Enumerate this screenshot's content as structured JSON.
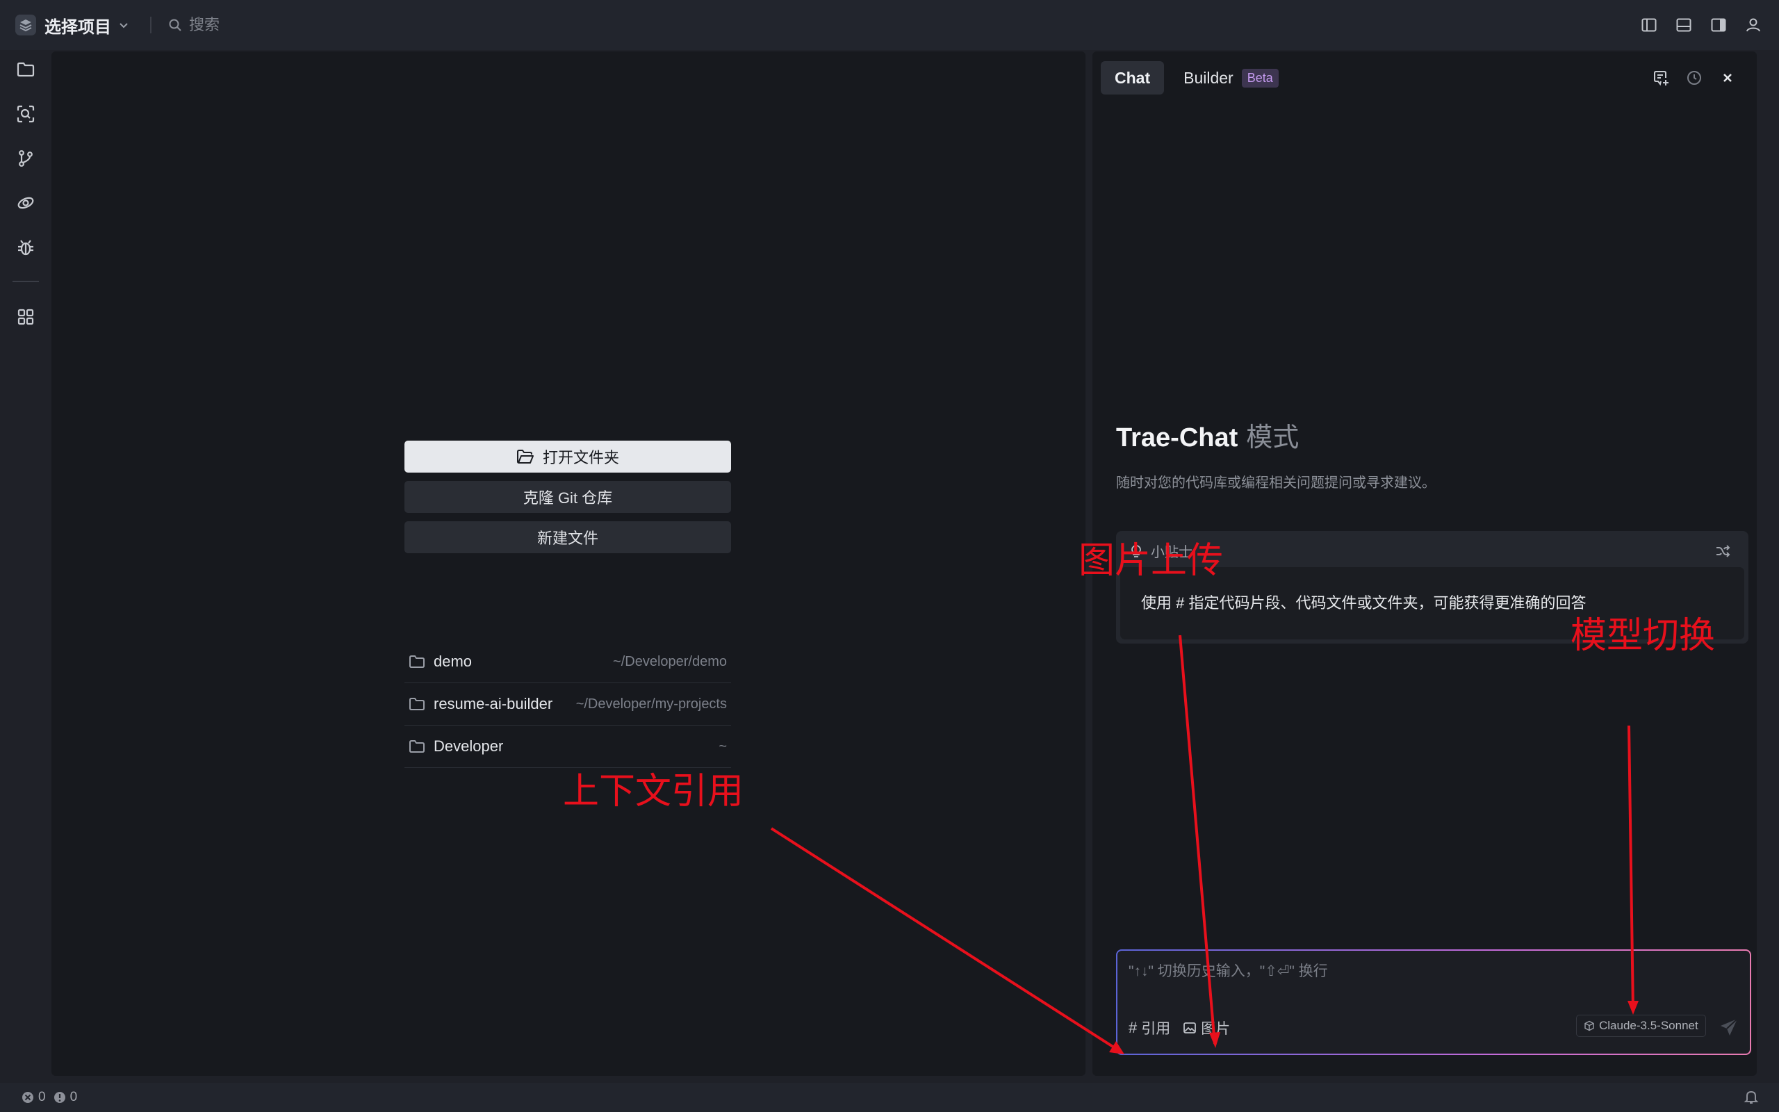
{
  "titlebar": {
    "project_name": "选择项目",
    "search_placeholder": "搜索"
  },
  "editor": {
    "actions": {
      "open_folder": "打开文件夹",
      "clone_git": "克隆 Git 仓库",
      "new_file": "新建文件"
    },
    "recent": [
      {
        "name": "demo",
        "path": "~/Developer/demo"
      },
      {
        "name": "resume-ai-builder",
        "path": "~/Developer/my-projects"
      },
      {
        "name": "Developer",
        "path": "~"
      }
    ]
  },
  "chat": {
    "tabs": {
      "chat": "Chat",
      "builder": "Builder",
      "beta": "Beta"
    },
    "welcome": {
      "title": "Trae-Chat",
      "mode": "模式",
      "subtitle": "随时对您的代码库或编程相关问题提问或寻求建议。"
    },
    "tip": {
      "label": "小贴士",
      "text": "使用 # 指定代码片段、代码文件或文件夹，可能获得更准确的回答"
    },
    "input": {
      "placeholder": "\"↑↓\" 切换历史输入，\"⇧⏎\" 换行",
      "reference_label": "引用",
      "image_label": "图片",
      "model": "Claude-3.5-Sonnet"
    }
  },
  "statusbar": {
    "errors": "0",
    "warnings": "0"
  },
  "annotations": {
    "image_upload": "图片上传",
    "model_switch": "模型切换",
    "context_reference": "上下文引用"
  },
  "colors": {
    "annotation": "#e8101c",
    "panel_bg": "#17191e",
    "chrome_bg": "#22252d"
  }
}
